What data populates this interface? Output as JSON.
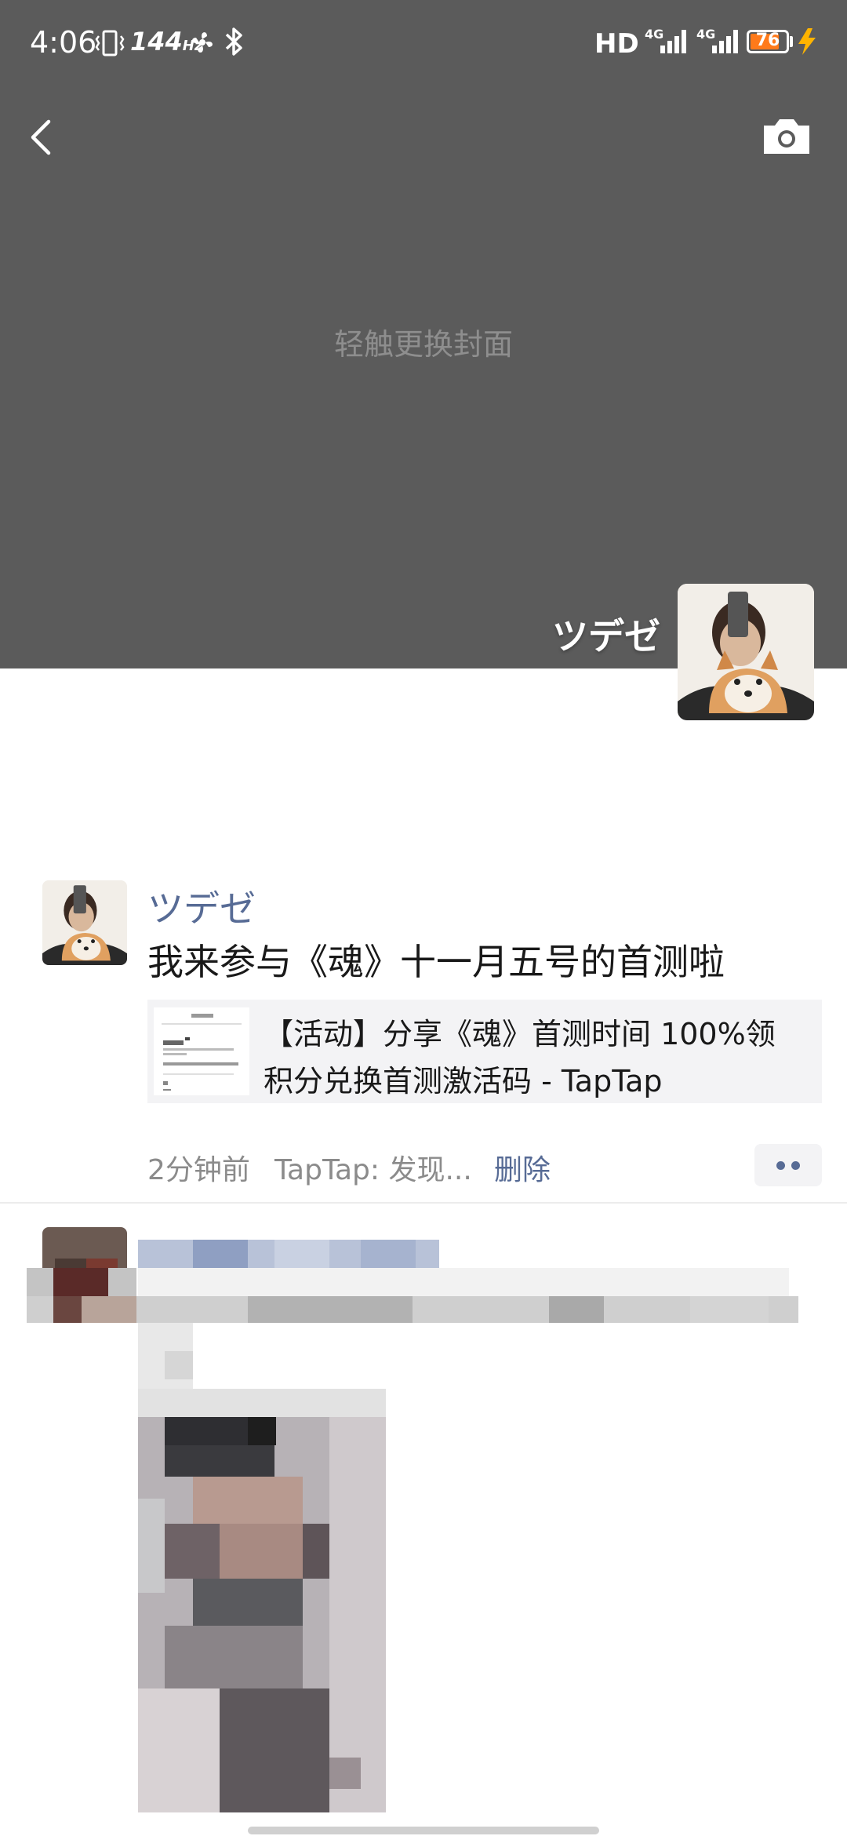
{
  "status_bar": {
    "time": "4:06",
    "refresh_rate": "144",
    "refresh_unit": "Hz",
    "network_hd": "HD",
    "network_type_1": "4G",
    "network_type_2": "4G",
    "battery_level": "76"
  },
  "cover": {
    "hint": "轻触更换封面",
    "color": "#5b5b5b"
  },
  "profile": {
    "name": "ツデゼ"
  },
  "post": {
    "user": "ツデゼ",
    "text": "我来参与《魂》十一月五号的首测啦",
    "link_title": "【活动】分享《魂》首测时间 100%领积分兑换首测激活码 - TapTap",
    "time": "2分钟前",
    "source": "TapTap: 发现...",
    "delete_label": "删除"
  },
  "colors": {
    "link_blue": "#576b95",
    "text_primary": "#191919",
    "text_secondary": "#8b8b8b"
  }
}
